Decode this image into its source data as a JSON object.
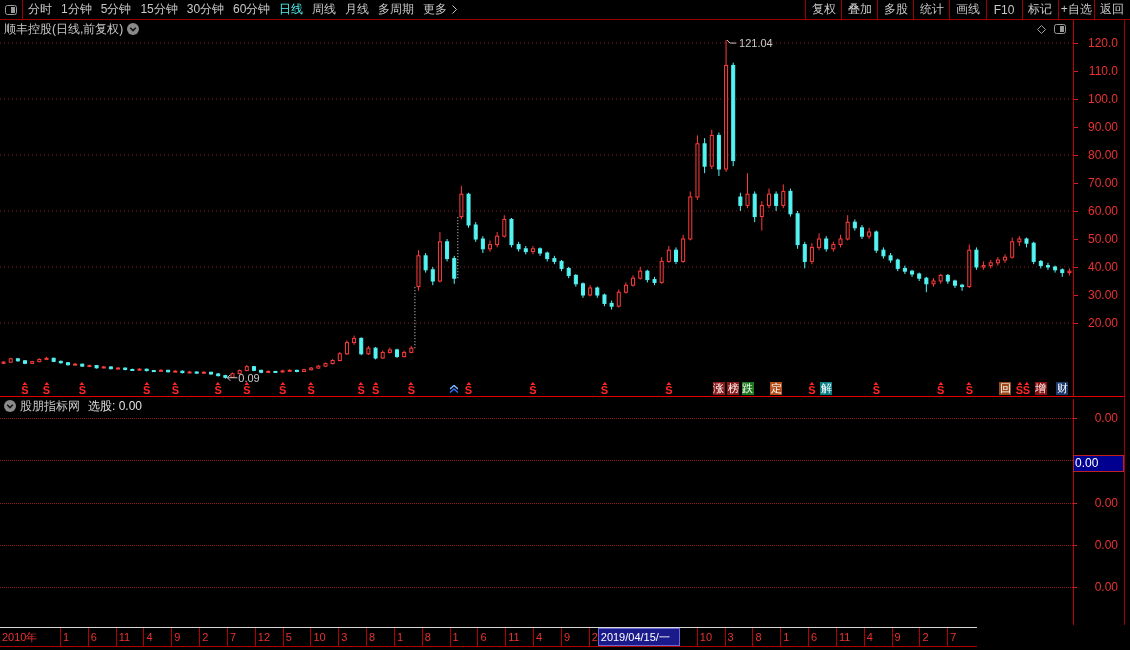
{
  "toolbar": {
    "periods": [
      {
        "label": "分时",
        "kind": "period",
        "selected": false
      },
      {
        "label": "1分钟",
        "kind": "period",
        "selected": false
      },
      {
        "label": "5分钟",
        "kind": "period",
        "selected": false
      },
      {
        "label": "15分钟",
        "kind": "period",
        "selected": false
      },
      {
        "label": "30分钟",
        "kind": "period",
        "selected": false
      },
      {
        "label": "60分钟",
        "kind": "period",
        "selected": false
      },
      {
        "label": "日线",
        "kind": "period",
        "selected": true
      },
      {
        "label": "周线",
        "kind": "period",
        "selected": false
      },
      {
        "label": "月线",
        "kind": "period",
        "selected": false
      },
      {
        "label": "多周期",
        "kind": "period",
        "selected": false
      },
      {
        "label": "更多",
        "kind": "menu",
        "selected": false
      }
    ],
    "buttons": [
      "复权",
      "叠加",
      "多股",
      "统计",
      "画线",
      "F10",
      "标记",
      "+自选",
      "返回"
    ]
  },
  "price_pane": {
    "title": "顺丰控股(日线,前复权)",
    "chart_data": {
      "type": "candlestick",
      "ylim": [
        -6.07,
        128.21
      ],
      "yticks": [
        {
          "value": 120,
          "label": "120.0"
        },
        {
          "value": 110,
          "label": "110.0"
        },
        {
          "value": 100,
          "label": "100.0"
        },
        {
          "value": 90,
          "label": "90.00"
        },
        {
          "value": 80,
          "label": "80.00"
        },
        {
          "value": 70,
          "label": "70.00"
        },
        {
          "value": 60,
          "label": "60.00"
        },
        {
          "value": 50,
          "label": "50.00"
        },
        {
          "value": 40,
          "label": "40.00"
        },
        {
          "value": 30,
          "label": "30.00"
        },
        {
          "value": 20,
          "label": "20.00"
        }
      ],
      "grid": true,
      "ohlc": [
        [
          5.6,
          6.4,
          5.3,
          6.0
        ],
        [
          6.0,
          7.6,
          5.8,
          7.2
        ],
        [
          7.2,
          7.5,
          6.2,
          6.5
        ],
        [
          6.5,
          6.8,
          5.3,
          5.6
        ],
        [
          5.6,
          6.5,
          5.4,
          6.2
        ],
        [
          6.2,
          7.4,
          6.0,
          7.0
        ],
        [
          7.0,
          7.9,
          6.8,
          7.4
        ],
        [
          7.4,
          7.6,
          6.0,
          6.3
        ],
        [
          6.3,
          6.6,
          5.5,
          5.8
        ],
        [
          5.8,
          6.0,
          4.8,
          5.1
        ],
        [
          5.1,
          5.7,
          4.9,
          5.3
        ],
        [
          5.3,
          5.5,
          4.3,
          4.6
        ],
        [
          4.6,
          5.2,
          4.4,
          4.8
        ],
        [
          4.8,
          5.0,
          3.7,
          4.0
        ],
        [
          4.0,
          4.7,
          3.8,
          4.3
        ],
        [
          4.3,
          4.5,
          3.4,
          3.7
        ],
        [
          3.7,
          4.3,
          3.5,
          3.9
        ],
        [
          3.9,
          4.1,
          3.1,
          3.4
        ],
        [
          3.4,
          3.7,
          2.9,
          3.2
        ],
        [
          3.2,
          3.9,
          3.0,
          3.5
        ],
        [
          3.5,
          3.7,
          2.7,
          3.0
        ],
        [
          3.0,
          3.2,
          2.5,
          2.8
        ],
        [
          2.8,
          3.5,
          2.6,
          3.1
        ],
        [
          3.1,
          3.3,
          2.3,
          2.6
        ],
        [
          2.6,
          3.2,
          2.4,
          2.8
        ],
        [
          2.8,
          3.0,
          2.0,
          2.3
        ],
        [
          2.3,
          2.9,
          2.1,
          2.5
        ],
        [
          2.5,
          2.7,
          1.8,
          2.1
        ],
        [
          2.1,
          2.8,
          1.9,
          2.4
        ],
        [
          2.4,
          2.6,
          1.5,
          1.8
        ],
        [
          1.8,
          2.1,
          0.9,
          1.2
        ],
        [
          1.2,
          1.5,
          0.09,
          0.6
        ],
        [
          0.6,
          2.3,
          0.4,
          1.9
        ],
        [
          1.9,
          3.4,
          1.7,
          3.0
        ],
        [
          3.0,
          5.0,
          2.8,
          4.4
        ],
        [
          4.4,
          4.6,
          2.8,
          3.1
        ],
        [
          3.1,
          3.3,
          2.1,
          2.4
        ],
        [
          2.4,
          3.1,
          2.2,
          2.7
        ],
        [
          2.7,
          2.9,
          2.2,
          2.5
        ],
        [
          2.5,
          3.3,
          2.3,
          2.9
        ],
        [
          2.9,
          3.5,
          2.7,
          3.1
        ],
        [
          3.1,
          3.3,
          2.4,
          2.7
        ],
        [
          2.7,
          3.7,
          2.5,
          3.3
        ],
        [
          3.3,
          4.3,
          3.1,
          3.9
        ],
        [
          3.9,
          5.0,
          3.7,
          4.6
        ],
        [
          4.6,
          5.9,
          4.3,
          5.5
        ],
        [
          5.5,
          7.1,
          5.2,
          6.6
        ],
        [
          6.6,
          9.6,
          6.3,
          9.0
        ],
        [
          9.0,
          13.8,
          8.6,
          13.0
        ],
        [
          13.0,
          15.5,
          12.2,
          14.5
        ],
        [
          14.5,
          14.9,
          8.5,
          9.0
        ],
        [
          9.0,
          11.8,
          8.6,
          11.0
        ],
        [
          11.0,
          11.4,
          7.0,
          7.5
        ],
        [
          7.5,
          10.2,
          7.2,
          9.5
        ],
        [
          9.5,
          11.2,
          9.1,
          10.4
        ],
        [
          10.4,
          10.8,
          7.6,
          8.0
        ],
        [
          8.0,
          10.1,
          7.7,
          9.5
        ],
        [
          9.5,
          11.8,
          9.2,
          11.0
        ],
        [
          33.0,
          46.0,
          31.5,
          44.0
        ],
        [
          44.0,
          45.0,
          38.0,
          39.0
        ],
        [
          39.0,
          40.0,
          33.5,
          35.0
        ],
        [
          35.0,
          52.5,
          34.5,
          49.0
        ],
        [
          49.0,
          50.0,
          42.0,
          43.0
        ],
        [
          43.0,
          44.0,
          34.0,
          36.0
        ],
        [
          58.0,
          69.0,
          57.0,
          66.0
        ],
        [
          66.0,
          66.5,
          54.0,
          55.0
        ],
        [
          55.0,
          56.0,
          49.0,
          50.0
        ],
        [
          50.0,
          51.0,
          45.0,
          46.5
        ],
        [
          46.5,
          49.5,
          45.5,
          48.0
        ],
        [
          48.0,
          52.5,
          47.0,
          51.0
        ],
        [
          51.0,
          58.5,
          50.5,
          57.0
        ],
        [
          57.0,
          57.5,
          47.0,
          48.0
        ],
        [
          48.0,
          49.0,
          45.5,
          46.5
        ],
        [
          46.5,
          47.5,
          44.5,
          45.5
        ],
        [
          45.5,
          47.5,
          44.5,
          46.5
        ],
        [
          46.5,
          47.0,
          44.0,
          45.0
        ],
        [
          45.0,
          45.5,
          42.0,
          43.0
        ],
        [
          43.0,
          44.0,
          41.0,
          42.0
        ],
        [
          42.0,
          42.5,
          38.5,
          39.5
        ],
        [
          39.5,
          40.0,
          36.0,
          37.0
        ],
        [
          37.0,
          37.5,
          33.0,
          34.0
        ],
        [
          34.0,
          34.5,
          29.0,
          30.0
        ],
        [
          30.0,
          33.5,
          29.5,
          32.5
        ],
        [
          32.5,
          33.0,
          29.0,
          30.0
        ],
        [
          30.0,
          30.5,
          26.0,
          27.0
        ],
        [
          27.0,
          28.0,
          24.8,
          26.0
        ],
        [
          26.0,
          32.0,
          25.5,
          31.0
        ],
        [
          31.0,
          34.5,
          30.5,
          33.5
        ],
        [
          33.5,
          37.0,
          33.0,
          36.0
        ],
        [
          36.0,
          40.0,
          35.5,
          38.5
        ],
        [
          38.5,
          39.0,
          34.5,
          35.5
        ],
        [
          35.5,
          36.5,
          33.5,
          34.5
        ],
        [
          34.5,
          43.5,
          34.0,
          42.0
        ],
        [
          42.0,
          47.5,
          41.5,
          46.0
        ],
        [
          46.0,
          47.0,
          41.0,
          42.0
        ],
        [
          42.0,
          51.5,
          41.5,
          50.0
        ],
        [
          50.0,
          67.0,
          49.5,
          65.0
        ],
        [
          65.0,
          87.0,
          64.0,
          84.0
        ],
        [
          84.0,
          86.0,
          73.5,
          76.0
        ],
        [
          76.0,
          89.0,
          75.0,
          87.0
        ],
        [
          87.0,
          88.0,
          72.5,
          75.0
        ],
        [
          75.0,
          121.04,
          74.0,
          112.0
        ],
        [
          112.0,
          113.0,
          76.0,
          78.0
        ],
        [
          65.0,
          66.5,
          60.0,
          62.0
        ],
        [
          62.0,
          73.5,
          61.0,
          66.0
        ],
        [
          66.0,
          67.0,
          56.0,
          58.0
        ],
        [
          58.0,
          63.5,
          53.0,
          62.0
        ],
        [
          62.0,
          68.0,
          61.0,
          66.0
        ],
        [
          66.0,
          67.0,
          60.0,
          62.0
        ],
        [
          62.0,
          69.5,
          61.0,
          67.0
        ],
        [
          67.0,
          68.0,
          58.0,
          59.0
        ],
        [
          59.0,
          60.0,
          46.5,
          48.0
        ],
        [
          48.0,
          49.0,
          39.5,
          42.0
        ],
        [
          42.0,
          48.5,
          41.0,
          47.0
        ],
        [
          47.0,
          52.0,
          46.0,
          50.0
        ],
        [
          50.0,
          51.0,
          45.5,
          46.5
        ],
        [
          46.5,
          49.0,
          45.5,
          48.0
        ],
        [
          48.0,
          51.5,
          47.0,
          50.0
        ],
        [
          50.0,
          58.5,
          49.5,
          56.0
        ],
        [
          56.0,
          57.0,
          53.0,
          54.0
        ],
        [
          54.0,
          55.0,
          50.0,
          51.0
        ],
        [
          51.0,
          54.0,
          50.0,
          52.5
        ],
        [
          52.5,
          53.0,
          45.0,
          46.0
        ],
        [
          46.0,
          47.0,
          43.0,
          44.0
        ],
        [
          44.0,
          45.0,
          41.5,
          42.5
        ],
        [
          42.5,
          43.0,
          38.5,
          39.5
        ],
        [
          39.5,
          40.5,
          37.5,
          38.5
        ],
        [
          38.5,
          39.0,
          36.5,
          37.5
        ],
        [
          37.5,
          38.0,
          35.0,
          36.0
        ],
        [
          36.0,
          36.5,
          31.0,
          34.0
        ],
        [
          34.0,
          36.0,
          33.0,
          35.0
        ],
        [
          35.0,
          37.5,
          34.0,
          37.0
        ],
        [
          37.0,
          37.5,
          34.0,
          35.0
        ],
        [
          35.0,
          35.5,
          32.5,
          33.5
        ],
        [
          33.5,
          34.0,
          31.5,
          33.0
        ],
        [
          33.0,
          48.0,
          32.5,
          46.0
        ],
        [
          46.0,
          47.0,
          39.0,
          40.0
        ],
        [
          40.0,
          42.0,
          39.0,
          40.5
        ],
        [
          40.5,
          42.5,
          39.5,
          41.5
        ],
        [
          41.5,
          43.5,
          40.5,
          42.5
        ],
        [
          42.5,
          44.5,
          41.5,
          43.5
        ],
        [
          43.5,
          50.5,
          43.0,
          49.0
        ],
        [
          49.0,
          51.0,
          47.5,
          50.0
        ],
        [
          50.0,
          50.5,
          47.0,
          48.5
        ],
        [
          48.5,
          49.0,
          41.0,
          42.0
        ],
        [
          42.0,
          42.5,
          39.5,
          40.5
        ],
        [
          40.5,
          41.5,
          39.0,
          40.0
        ],
        [
          40.0,
          40.5,
          38.0,
          39.0
        ],
        [
          39.0,
          39.5,
          36.5,
          38.0
        ],
        [
          38.0,
          39.5,
          37.0,
          38.5
        ]
      ],
      "annotations": [
        "121.04",
        "0.09"
      ]
    },
    "events": [
      {
        "kind": "s",
        "label": "S"
      },
      {
        "kind": "s",
        "label": "S"
      },
      {
        "kind": "s",
        "label": "S"
      },
      {
        "kind": "s",
        "label": "S"
      },
      {
        "kind": "s",
        "label": "S"
      },
      {
        "kind": "s",
        "label": "S"
      },
      {
        "kind": "s",
        "label": "S"
      },
      {
        "kind": "s",
        "label": "S"
      },
      {
        "kind": "s",
        "label": "S"
      },
      {
        "kind": "s",
        "label": "S"
      },
      {
        "kind": "s",
        "label": "S"
      },
      {
        "kind": "s",
        "label": "S"
      },
      {
        "kind": "up"
      },
      {
        "kind": "s",
        "label": "S"
      },
      {
        "kind": "s",
        "label": "S"
      },
      {
        "kind": "s",
        "label": "S"
      },
      {
        "kind": "s",
        "label": "S"
      },
      {
        "kind": "badge",
        "label": "涨",
        "color": "#8b1a1a"
      },
      {
        "kind": "badge",
        "label": "榜",
        "color": "#8b1a1a"
      },
      {
        "kind": "badge",
        "label": "跌",
        "color": "#1f7a1f"
      },
      {
        "kind": "badge",
        "label": "定",
        "color": "#b4501c"
      },
      {
        "kind": "s",
        "label": "S"
      },
      {
        "kind": "badge",
        "label": "解",
        "color": "#0a7f86"
      },
      {
        "kind": "s",
        "label": "S"
      },
      {
        "kind": "s",
        "label": "S"
      },
      {
        "kind": "s",
        "label": "S"
      },
      {
        "kind": "badge",
        "label": "回",
        "color": "#9a4a1c"
      },
      {
        "kind": "s",
        "label": "S"
      },
      {
        "kind": "s",
        "label": "S"
      },
      {
        "kind": "badge",
        "label": "增",
        "color": "#8b1010"
      },
      {
        "kind": "badge",
        "label": "财",
        "color": "#1d3a6b"
      }
    ]
  },
  "indicator_pane": {
    "name": "股朋指标网",
    "reading": "选股: 0.00",
    "axis_labels": [
      {
        "text": "0.00",
        "kind": "tick"
      },
      {
        "text": "0.00",
        "kind": "cursor"
      },
      {
        "text": "0.00",
        "kind": "tick"
      },
      {
        "text": "0.00",
        "kind": "tick"
      },
      {
        "text": "0.00",
        "kind": "tick"
      }
    ]
  },
  "time_axis": {
    "labels": [
      {
        "text": "2010年",
        "kind": "year"
      },
      {
        "text": "1",
        "kind": "tick"
      },
      {
        "text": "6",
        "kind": "tick"
      },
      {
        "text": "11",
        "kind": "tick"
      },
      {
        "text": "4",
        "kind": "tick"
      },
      {
        "text": "9",
        "kind": "tick"
      },
      {
        "text": "2",
        "kind": "tick"
      },
      {
        "text": "7",
        "kind": "tick"
      },
      {
        "text": "12",
        "kind": "tick"
      },
      {
        "text": "5",
        "kind": "tick"
      },
      {
        "text": "10",
        "kind": "tick"
      },
      {
        "text": "3",
        "kind": "tick"
      },
      {
        "text": "8",
        "kind": "tick"
      },
      {
        "text": "1",
        "kind": "tick"
      },
      {
        "text": "8",
        "kind": "tick"
      },
      {
        "text": "1",
        "kind": "tick"
      },
      {
        "text": "6",
        "kind": "tick"
      },
      {
        "text": "11",
        "kind": "tick"
      },
      {
        "text": "4",
        "kind": "tick"
      },
      {
        "text": "9",
        "kind": "tick"
      },
      {
        "text": "2",
        "kind": "tick"
      },
      {
        "text": "2019/04/15/一",
        "kind": "cursor"
      },
      {
        "text": "10",
        "kind": "tick"
      },
      {
        "text": "3",
        "kind": "tick"
      },
      {
        "text": "8",
        "kind": "tick"
      },
      {
        "text": "1",
        "kind": "tick"
      },
      {
        "text": "6",
        "kind": "tick"
      },
      {
        "text": "11",
        "kind": "tick"
      },
      {
        "text": "4",
        "kind": "tick"
      },
      {
        "text": "9",
        "kind": "tick"
      },
      {
        "text": "2",
        "kind": "tick"
      },
      {
        "text": "7",
        "kind": "tick"
      }
    ]
  }
}
